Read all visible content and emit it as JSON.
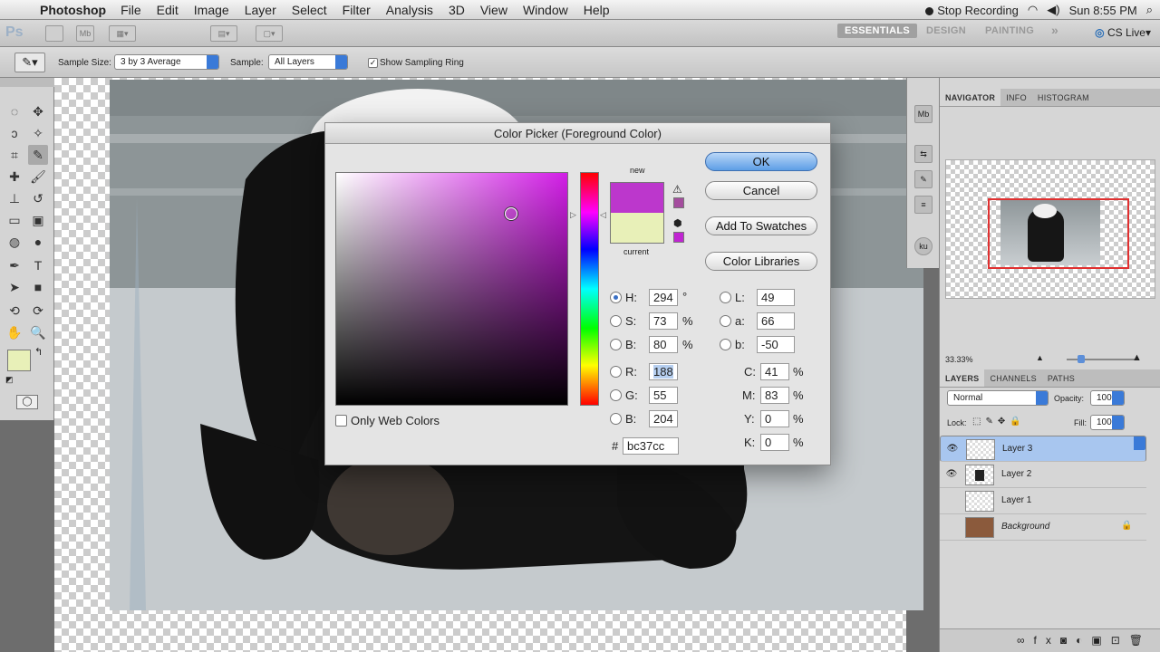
{
  "menubar": {
    "app_name": "Photoshop",
    "items": [
      "File",
      "Edit",
      "Image",
      "Layer",
      "Select",
      "Filter",
      "Analysis",
      "3D",
      "View",
      "Window",
      "Help"
    ],
    "stop_recording": "Stop Recording",
    "clock": "Sun 8:55 PM"
  },
  "appbar": {
    "logo": "Ps",
    "mb": "Mb",
    "workspaces": [
      "ESSENTIALS",
      "DESIGN",
      "PAINTING"
    ],
    "more": "»",
    "cs_live": "CS Live"
  },
  "options": {
    "sample_size_label": "Sample Size:",
    "sample_size_value": "3 by 3 Average",
    "sample_label": "Sample:",
    "sample_value": "All Layers",
    "show_ring_label": "Show Sampling Ring"
  },
  "dialog": {
    "title": "Color Picker (Foreground Color)",
    "new_label": "new",
    "current_label": "current",
    "new_color": "#bc37cc",
    "current_color": "#e8f0b8",
    "ok": "OK",
    "cancel": "Cancel",
    "add_swatches": "Add To Swatches",
    "libraries": "Color Libraries",
    "only_web": "Only Web Colors",
    "hsb": {
      "H": "294",
      "S": "73",
      "B": "80"
    },
    "rgb": {
      "R": "188",
      "G": "55",
      "B": "204"
    },
    "lab": {
      "L": "49",
      "a": "66",
      "b": "-50"
    },
    "cmyk": {
      "C": "41",
      "M": "83",
      "Y": "0",
      "K": "0"
    },
    "hex_label": "#",
    "hex": "bc37cc",
    "deg": "°",
    "pct": "%"
  },
  "panels": {
    "nav_tabs": [
      "NAVIGATOR",
      "INFO",
      "HISTOGRAM"
    ],
    "zoom": "33.33%",
    "layer_tabs": [
      "LAYERS",
      "CHANNELS",
      "PATHS"
    ],
    "blend_mode": "Normal",
    "opacity_label": "Opacity:",
    "opacity": "100%",
    "lock_label": "Lock:",
    "fill_label": "Fill:",
    "fill": "100%",
    "layers": [
      "Layer 3",
      "Layer 2",
      "Layer 1",
      "Background"
    ]
  },
  "colors": {
    "foreground": "#e8f0b8",
    "selection": "#a8c6ef",
    "accent": "#3a7ad8"
  },
  "icons": [
    "apple-icon",
    "record-icon",
    "wifi-icon",
    "volume-icon",
    "search-icon",
    "eye-icon",
    "lock-icon",
    "warning-icon",
    "cube-icon"
  ]
}
